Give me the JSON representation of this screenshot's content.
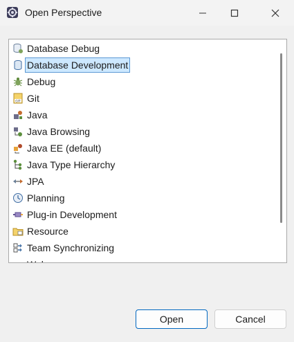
{
  "window": {
    "title": "Open Perspective",
    "app_icon": "eclipse-gear-icon"
  },
  "controls": {
    "minimize_icon": "minimize-icon",
    "maximize_icon": "maximize-icon",
    "close_icon": "close-icon"
  },
  "perspectives": [
    {
      "label": "Database Debug",
      "icon": "database-debug-icon"
    },
    {
      "label": "Database Development",
      "icon": "database-development-icon",
      "selected": true
    },
    {
      "label": "Debug",
      "icon": "debug-bug-icon"
    },
    {
      "label": "Git",
      "icon": "git-icon"
    },
    {
      "label": "Java",
      "icon": "java-icon"
    },
    {
      "label": "Java Browsing",
      "icon": "java-browsing-icon"
    },
    {
      "label": "Java EE (default)",
      "icon": "java-ee-icon"
    },
    {
      "label": "Java Type Hierarchy",
      "icon": "type-hierarchy-icon"
    },
    {
      "label": "JPA",
      "icon": "jpa-icon"
    },
    {
      "label": "Planning",
      "icon": "planning-icon"
    },
    {
      "label": "Plug-in Development",
      "icon": "plugin-icon"
    },
    {
      "label": "Resource",
      "icon": "resource-folder-icon"
    },
    {
      "label": "Team Synchronizing",
      "icon": "team-sync-icon"
    },
    {
      "label": "Web",
      "icon": "web-icon"
    }
  ],
  "buttons": {
    "open": "Open",
    "cancel": "Cancel"
  },
  "colors": {
    "selection_bg": "#cde8ff",
    "selection_border": "#5b98d4",
    "primary_border": "#0067c0"
  }
}
